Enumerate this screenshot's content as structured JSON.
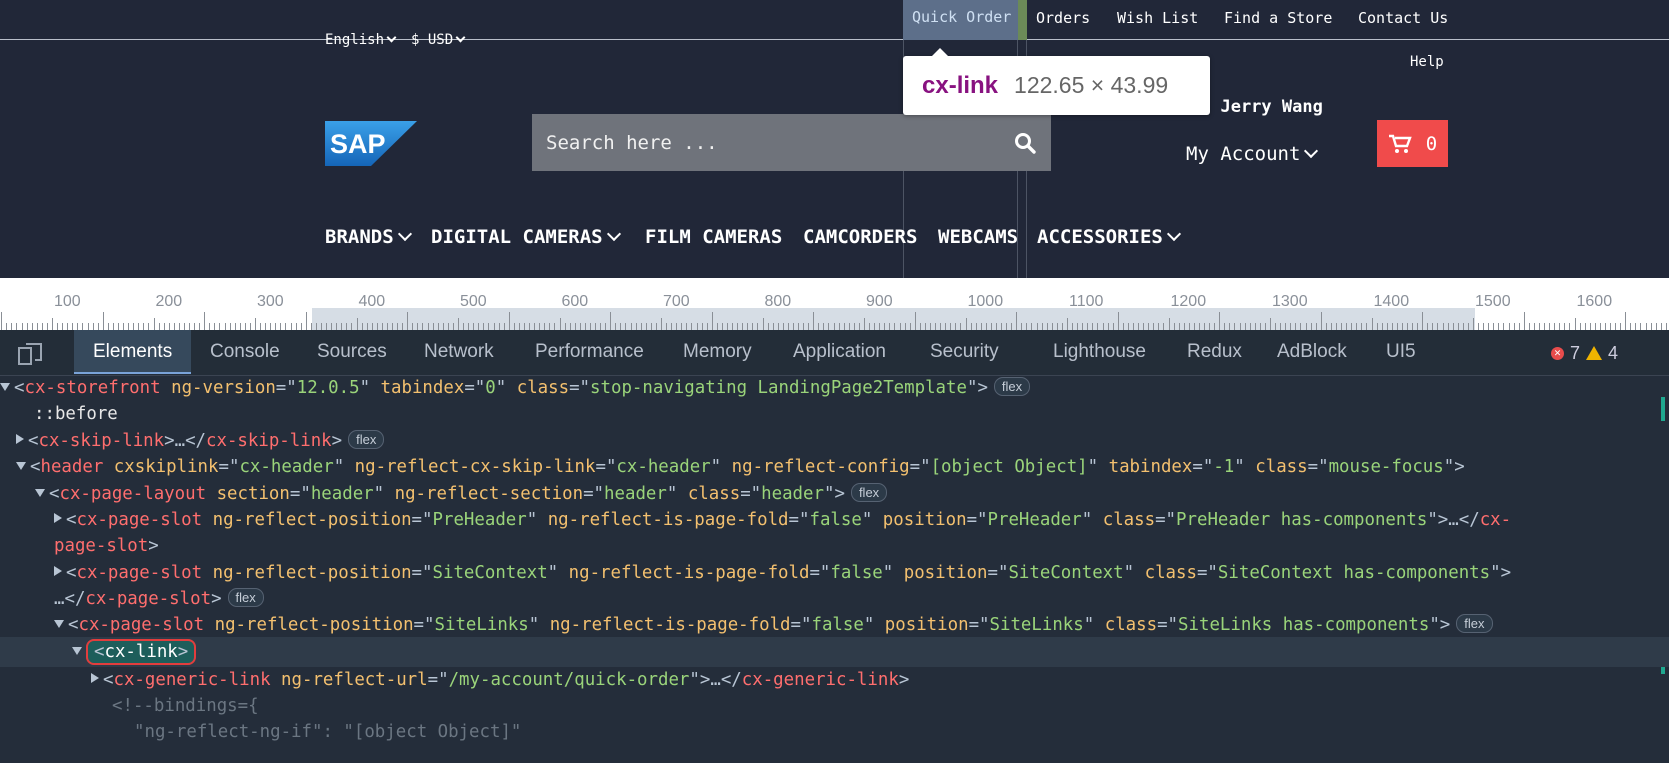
{
  "storefront": {
    "top_links": [
      "Quick Order",
      "Orders",
      "Wish List",
      "Find a Store",
      "Contact Us"
    ],
    "active_link": "Quick Order",
    "language": "English",
    "currency": "$ USD",
    "help": "Help",
    "welcome": ", Jerry Wang",
    "my_account": "My Account",
    "cart_count": "0",
    "logo_text": "SAP",
    "search_placeholder": "Search here ...",
    "nav": [
      "BRANDS",
      "DIGITAL CAMERAS",
      "FILM CAMERAS",
      "CAMCORDERS",
      "WEBCAMS",
      "ACCESSORIES"
    ]
  },
  "tooltip": {
    "element": "cx-link",
    "size": "122.65 × 43.99"
  },
  "ruler": {
    "labels": [
      "100",
      "200",
      "300",
      "400",
      "500",
      "600",
      "700",
      "800",
      "900",
      "1000",
      "1100",
      "1200",
      "1300",
      "1400",
      "1500",
      "1600"
    ]
  },
  "devtools": {
    "tabs": [
      "Elements",
      "Console",
      "Sources",
      "Network",
      "Performance",
      "Memory",
      "Application",
      "Security",
      "Lighthouse",
      "Redux",
      "AdBlock",
      "UI5"
    ],
    "active_tab": "Elements",
    "error_count": "7",
    "warning_count": "4",
    "flex_badge": "flex",
    "tree": {
      "l1_tag": "cx-storefront",
      "l1_attrs": [
        [
          "ng-version",
          "12.0.5"
        ],
        [
          "tabindex",
          "0"
        ],
        [
          "class",
          "stop-navigating LandingPage2Template"
        ]
      ],
      "l2": "::before",
      "l3_tag": "cx-skip-link",
      "l4_tag": "header",
      "l4_attrs": [
        [
          "cxskiplink",
          "cx-header"
        ],
        [
          "ng-reflect-cx-skip-link",
          "cx-header"
        ],
        [
          "ng-reflect-config",
          "[object Object]"
        ],
        [
          "tabindex",
          "-1"
        ],
        [
          "class",
          "mouse-focus"
        ]
      ],
      "l5_tag": "cx-page-layout",
      "l5_attrs": [
        [
          "section",
          "header"
        ],
        [
          "ng-reflect-section",
          "header"
        ],
        [
          "class",
          "header"
        ]
      ],
      "l6_tag": "cx-page-slot",
      "l6_attrs": [
        [
          "ng-reflect-position",
          "PreHeader"
        ],
        [
          "ng-reflect-is-page-fold",
          "false"
        ],
        [
          "position",
          "PreHeader"
        ],
        [
          "class",
          "PreHeader has-components"
        ]
      ],
      "l7_attrs": [
        [
          "ng-reflect-position",
          "SiteContext"
        ],
        [
          "ng-reflect-is-page-fold",
          "false"
        ],
        [
          "position",
          "SiteContext"
        ],
        [
          "class",
          "SiteContext has-components"
        ]
      ],
      "l8_attrs": [
        [
          "ng-reflect-position",
          "SiteLinks"
        ],
        [
          "ng-reflect-is-page-fold",
          "false"
        ],
        [
          "position",
          "SiteLinks"
        ],
        [
          "class",
          "SiteLinks has-components"
        ]
      ],
      "l9_tag": "cx-link",
      "l10_tag": "cx-generic-link",
      "l10_attrs": [
        [
          "ng-reflect-url",
          "/my-account/quick-order"
        ]
      ],
      "l11": "<!--bindings={",
      "l12": "\"ng-reflect-ng-if\": \"[object Object]\""
    }
  }
}
